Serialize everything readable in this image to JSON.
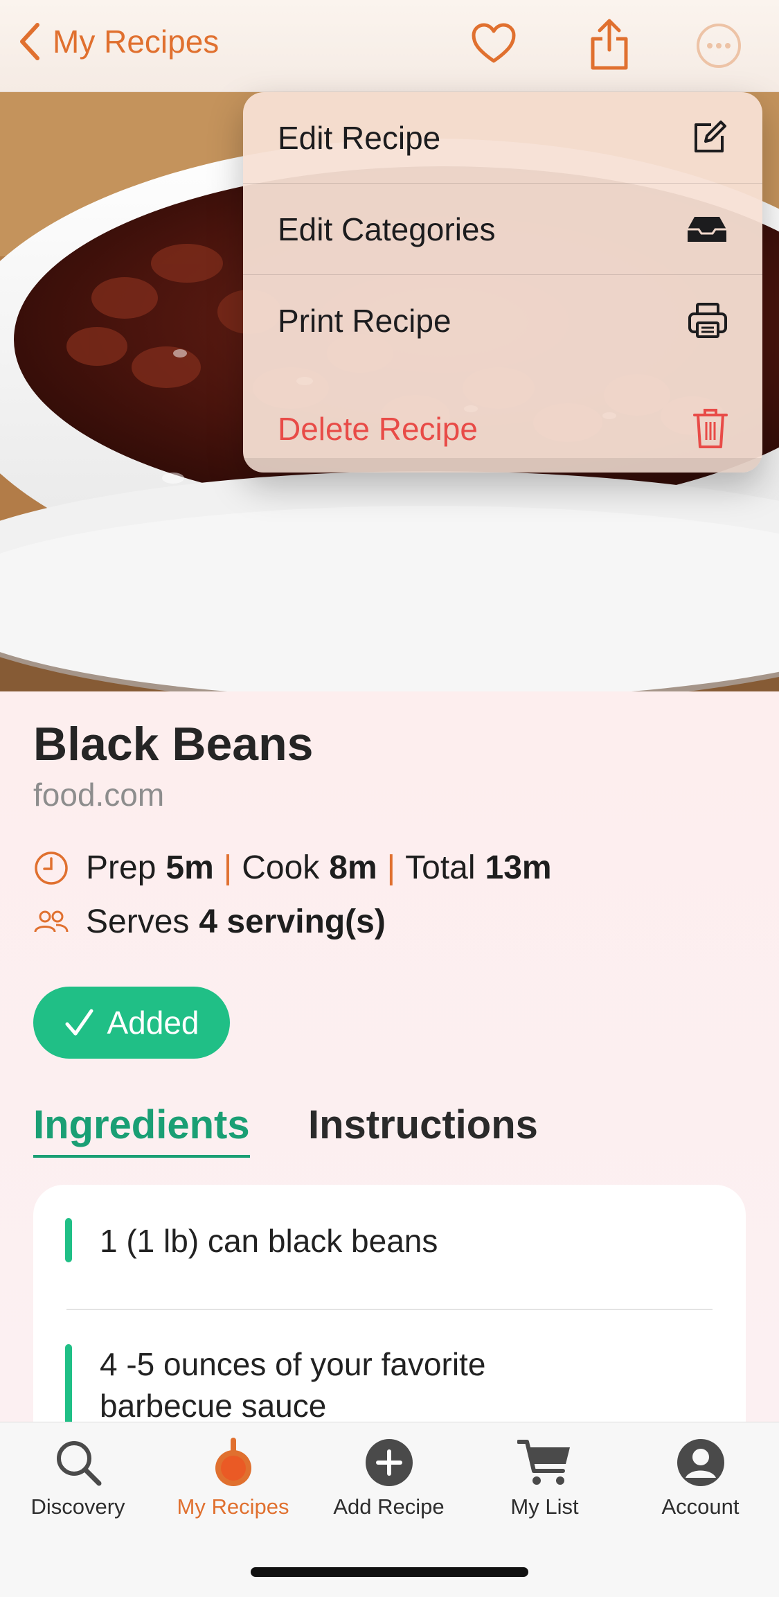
{
  "nav": {
    "back_label": "My Recipes"
  },
  "menu": {
    "items": [
      {
        "label": "Edit Recipe",
        "icon": "edit-icon"
      },
      {
        "label": "Edit Categories",
        "icon": "tray-icon"
      },
      {
        "label": "Print Recipe",
        "icon": "printer-icon"
      }
    ],
    "delete_label": "Delete Recipe",
    "delete_icon": "trash-icon"
  },
  "recipe": {
    "title": "Black Beans",
    "source": "food.com",
    "prep_label": "Prep",
    "prep_value": "5m",
    "cook_label": "Cook",
    "cook_value": "8m",
    "total_label": "Total",
    "total_value": "13m",
    "serves_label": "Serves",
    "serves_value": "4 serving(s)",
    "separator": "|"
  },
  "added_label": "Added",
  "tabs": {
    "ingredients": "Ingredients",
    "instructions": "Instructions"
  },
  "ingredients": [
    "1 (1 lb) can black beans",
    "4 -5 ounces of your favorite barbecue sauce"
  ],
  "tabbar": [
    {
      "label": "Discovery",
      "icon": "search-icon"
    },
    {
      "label": "My Recipes",
      "icon": "pan-icon",
      "active": true
    },
    {
      "label": "Add Recipe",
      "icon": "plus-circle-icon"
    },
    {
      "label": "My List",
      "icon": "cart-icon"
    },
    {
      "label": "Account",
      "icon": "account-icon"
    }
  ],
  "colors": {
    "accent": "#e0702f",
    "green": "#20bf86",
    "delete": "#e84b47"
  }
}
